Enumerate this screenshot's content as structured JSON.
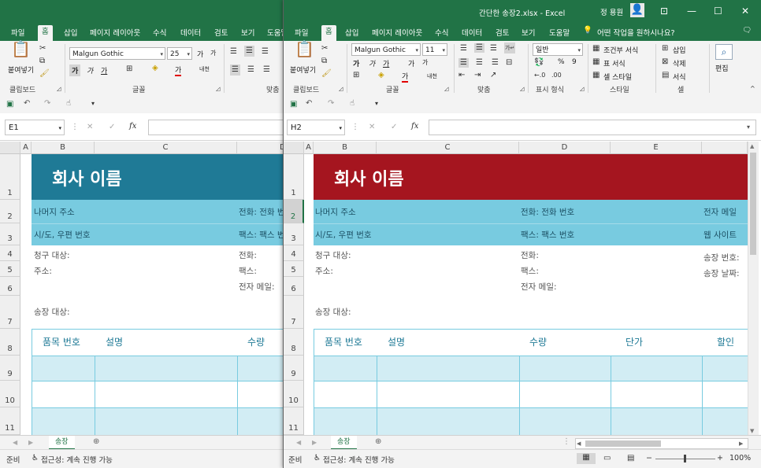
{
  "titlebar": {
    "title": "간단한 송장2.xlsx  -  Excel",
    "user": "정 용원"
  },
  "tabs": [
    "파일",
    "홈",
    "삽입",
    "페이지 레이아웃",
    "수식",
    "데이터",
    "검토",
    "보기",
    "도움말"
  ],
  "tellme": "어떤 작업을 원하시나요?",
  "ribbon": {
    "clipboard": {
      "paste": "붙여넣기",
      "label": "클립보드"
    },
    "font": {
      "label": "글꼴",
      "bold": "가",
      "italic": "가",
      "underline": "가",
      "grow": "가",
      "shrink": "가",
      "fontcolor": "가",
      "phonetic": "내천",
      "left_name": "Malgun Gothic",
      "left_size": "25",
      "right_name": "Malgun Gothic",
      "right_size": "11"
    },
    "align": {
      "label": "맞춤",
      "left_label": "맞춤"
    },
    "number": {
      "format": "일반",
      "label": "표시 형식",
      "percent": "%",
      "comma": "9"
    },
    "styles": {
      "conditional": "조건부 서식",
      "table": "표 서식",
      "cell": "셀 스타일",
      "label": "스타일"
    },
    "cells": {
      "insert": "삽입",
      "delete": "삭제",
      "format": "서식",
      "label": "셀"
    },
    "edit": {
      "label": "편집"
    }
  },
  "left": {
    "namebox": "E1",
    "columns": [
      "A",
      "B",
      "C",
      "D"
    ],
    "rows": [
      "1",
      "2",
      "3",
      "4",
      "5",
      "6",
      "7",
      "8",
      "9",
      "10",
      "11"
    ],
    "company": "회사 이름",
    "address": "나머지 주소",
    "phone": "전화: 전화 번",
    "city": "시/도, 우편 번호",
    "fax": "팩스: 팩스 번",
    "bill_to": "청구 대상:",
    "bill_phone": "전화:",
    "address_label": "주소:",
    "bill_fax": "팩스:",
    "bill_email": "전자 메일:",
    "ship_to": "송장 대상:",
    "th_item": "품목 번호",
    "th_desc": "설명",
    "th_qty": "수량"
  },
  "right": {
    "namebox": "H2",
    "columns": [
      "A",
      "B",
      "C",
      "D",
      "E"
    ],
    "rows": [
      "1",
      "2",
      "3",
      "4",
      "5",
      "6",
      "7",
      "8",
      "9",
      "10",
      "11"
    ],
    "company": "회사 이름",
    "address": "나머지 주소",
    "phone": "전화: 전화 번호",
    "email": "전자 메일",
    "city": "시/도, 우편 번호",
    "fax": "팩스: 팩스 번호",
    "website": "웹 사이트",
    "bill_to": "청구 대상:",
    "bill_phone": "전화:",
    "invoice_no": "송장 번호:",
    "address_label": "주소:",
    "bill_fax": "팩스:",
    "invoice_date": "송장 날짜:",
    "bill_email": "전자 메일:",
    "ship_to": "송장 대상:",
    "th_item": "품목 번호",
    "th_desc": "설명",
    "th_qty": "수량",
    "th_price": "단가",
    "th_disc": "할인"
  },
  "sheet_tab": "송장",
  "status": {
    "ready": "준비",
    "accessibility": "접근성: 계속 진행 가능",
    "zoom": "100%"
  },
  "colors": {
    "excel_green": "#217346",
    "teal_header": "#1f7a96",
    "red_header": "#a5151f",
    "light_blue": "#78cbe0",
    "table_fill": "#d2edf4"
  }
}
